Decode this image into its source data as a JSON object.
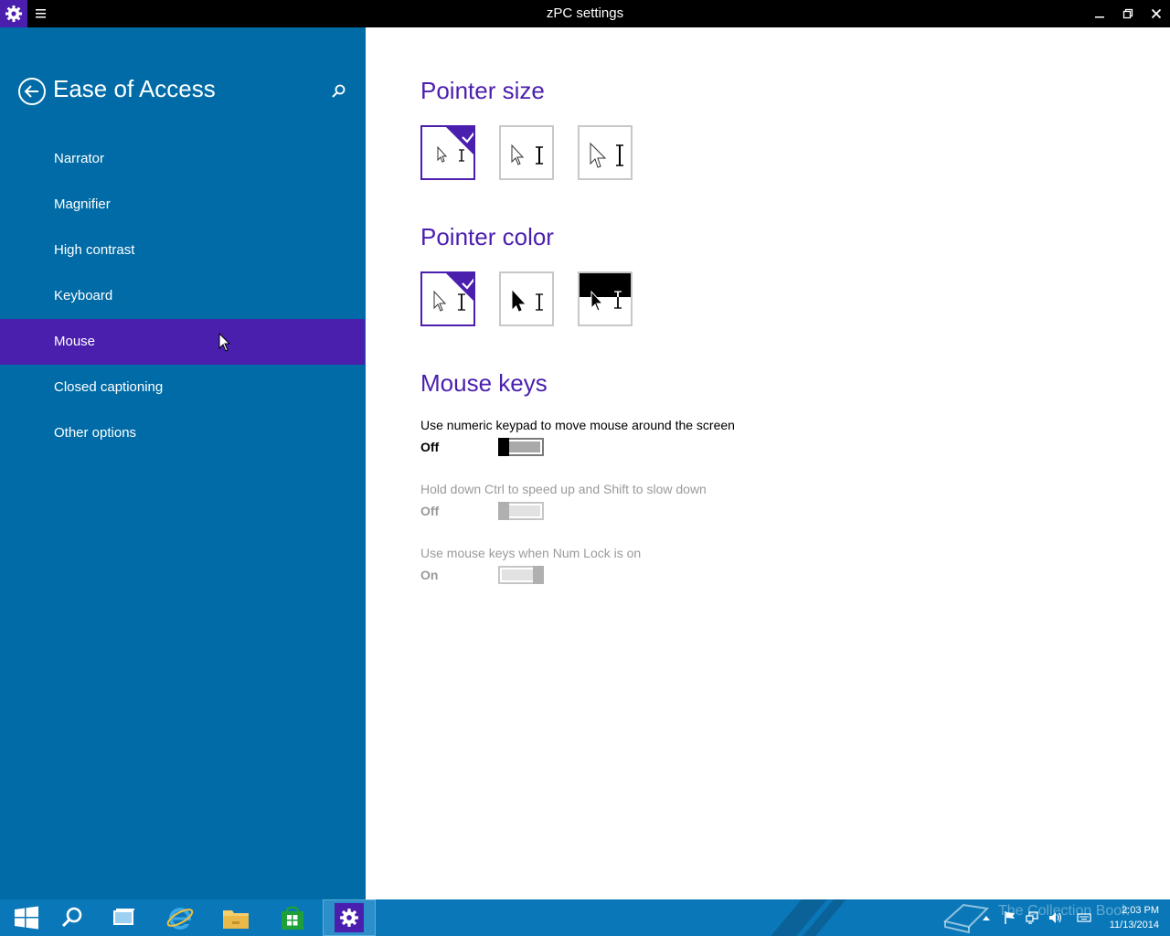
{
  "window": {
    "title": "zPC settings"
  },
  "sidebar": {
    "title": "Ease of Access",
    "items": [
      {
        "label": "Narrator"
      },
      {
        "label": "Magnifier"
      },
      {
        "label": "High contrast"
      },
      {
        "label": "Keyboard"
      },
      {
        "label": "Mouse",
        "active": true
      },
      {
        "label": "Closed captioning"
      },
      {
        "label": "Other options"
      }
    ]
  },
  "main": {
    "pointer_size": {
      "heading": "Pointer size",
      "options": [
        {
          "size": "small",
          "selected": true
        },
        {
          "size": "medium",
          "selected": false
        },
        {
          "size": "large",
          "selected": false
        }
      ]
    },
    "pointer_color": {
      "heading": "Pointer color",
      "options": [
        {
          "color": "white",
          "selected": true
        },
        {
          "color": "black",
          "selected": false
        },
        {
          "color": "inverted",
          "selected": false
        }
      ]
    },
    "mouse_keys": {
      "heading": "Mouse keys",
      "settings": [
        {
          "label": "Use numeric keypad to move mouse around the screen",
          "state": "Off",
          "enabled": true
        },
        {
          "label": "Hold down Ctrl to speed up and Shift to slow down",
          "state": "Off",
          "enabled": false
        },
        {
          "label": "Use mouse keys when Num Lock is on",
          "state": "On",
          "enabled": false
        }
      ]
    }
  },
  "taskbar": {
    "apps": [
      "start-icon",
      "search-icon",
      "task-view-icon",
      "internet-explorer-icon",
      "file-explorer-icon",
      "store-icon",
      "settings-icon"
    ],
    "watermark": "The Collection Book",
    "time": "2:03 PM",
    "date": "11/13/2014"
  },
  "colors": {
    "accent": "#4b1fae",
    "sidebar": "#006ba6",
    "taskbar": "#0a78b8"
  }
}
